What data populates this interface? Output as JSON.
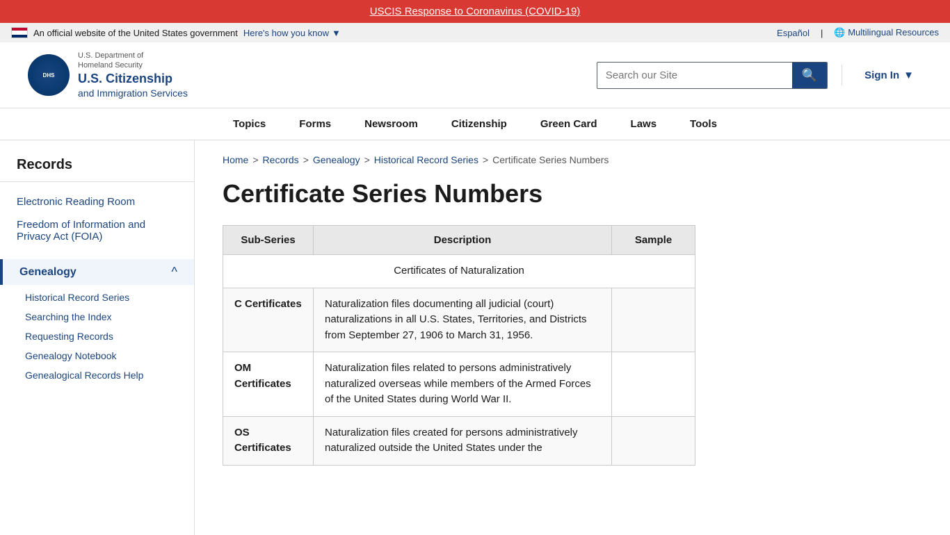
{
  "alert": {
    "text": "USCIS Response to Coronavirus (COVID-19)",
    "url": "#"
  },
  "official": {
    "text": "An official website of the United States government",
    "how_know": "Here's how you know",
    "espanol": "Español",
    "multilingual": "Multilingual Resources"
  },
  "header": {
    "dept": "U.S. Department of",
    "agency": "U.S. Citizenship",
    "agency2": "and Immigration",
    "sub": "Services",
    "search_placeholder": "Search our Site",
    "sign_in": "Sign In"
  },
  "nav": {
    "items": [
      {
        "label": "Topics",
        "url": "#"
      },
      {
        "label": "Forms",
        "url": "#"
      },
      {
        "label": "Newsroom",
        "url": "#"
      },
      {
        "label": "Citizenship",
        "url": "#"
      },
      {
        "label": "Green Card",
        "url": "#"
      },
      {
        "label": "Laws",
        "url": "#"
      },
      {
        "label": "Tools",
        "url": "#"
      }
    ]
  },
  "sidebar": {
    "title": "Records",
    "top_links": [
      {
        "label": "Electronic Reading Room",
        "url": "#"
      },
      {
        "label": "Freedom of Information and Privacy Act (FOIA)",
        "url": "#"
      }
    ],
    "genealogy": {
      "title": "Genealogy",
      "sub_links": [
        {
          "label": "Historical Record Series",
          "url": "#"
        },
        {
          "label": "Searching the Index",
          "url": "#"
        },
        {
          "label": "Requesting Records",
          "url": "#"
        },
        {
          "label": "Genealogy Notebook",
          "url": "#"
        },
        {
          "label": "Genealogical Records Help",
          "url": "#"
        }
      ]
    }
  },
  "breadcrumb": {
    "items": [
      {
        "label": "Home",
        "url": "#"
      },
      {
        "label": "Records",
        "url": "#"
      },
      {
        "label": "Genealogy",
        "url": "#"
      },
      {
        "label": "Historical Record Series",
        "url": "#"
      },
      {
        "label": "Certificate Series Numbers",
        "url": null
      }
    ]
  },
  "page": {
    "title": "Certificate Series Numbers"
  },
  "table": {
    "headers": [
      "Sub-Series",
      "Description",
      "Sample"
    ],
    "section_header": "Certificates of Naturalization",
    "rows": [
      {
        "sub_series": "C Certificates",
        "description": "Naturalization files documenting all judicial (court) naturalizations in all U.S. States, Territories, and Districts from September 27, 1906 to March 31, 1956.",
        "sample": ""
      },
      {
        "sub_series": "OM Certificates",
        "description": "Naturalization files related to persons administratively naturalized overseas while members of the Armed Forces of the United States during World War II.",
        "sample": ""
      },
      {
        "sub_series": "OS Certificates",
        "description": "Naturalization files created for persons administratively naturalized outside the United States under the",
        "sample": ""
      }
    ]
  }
}
